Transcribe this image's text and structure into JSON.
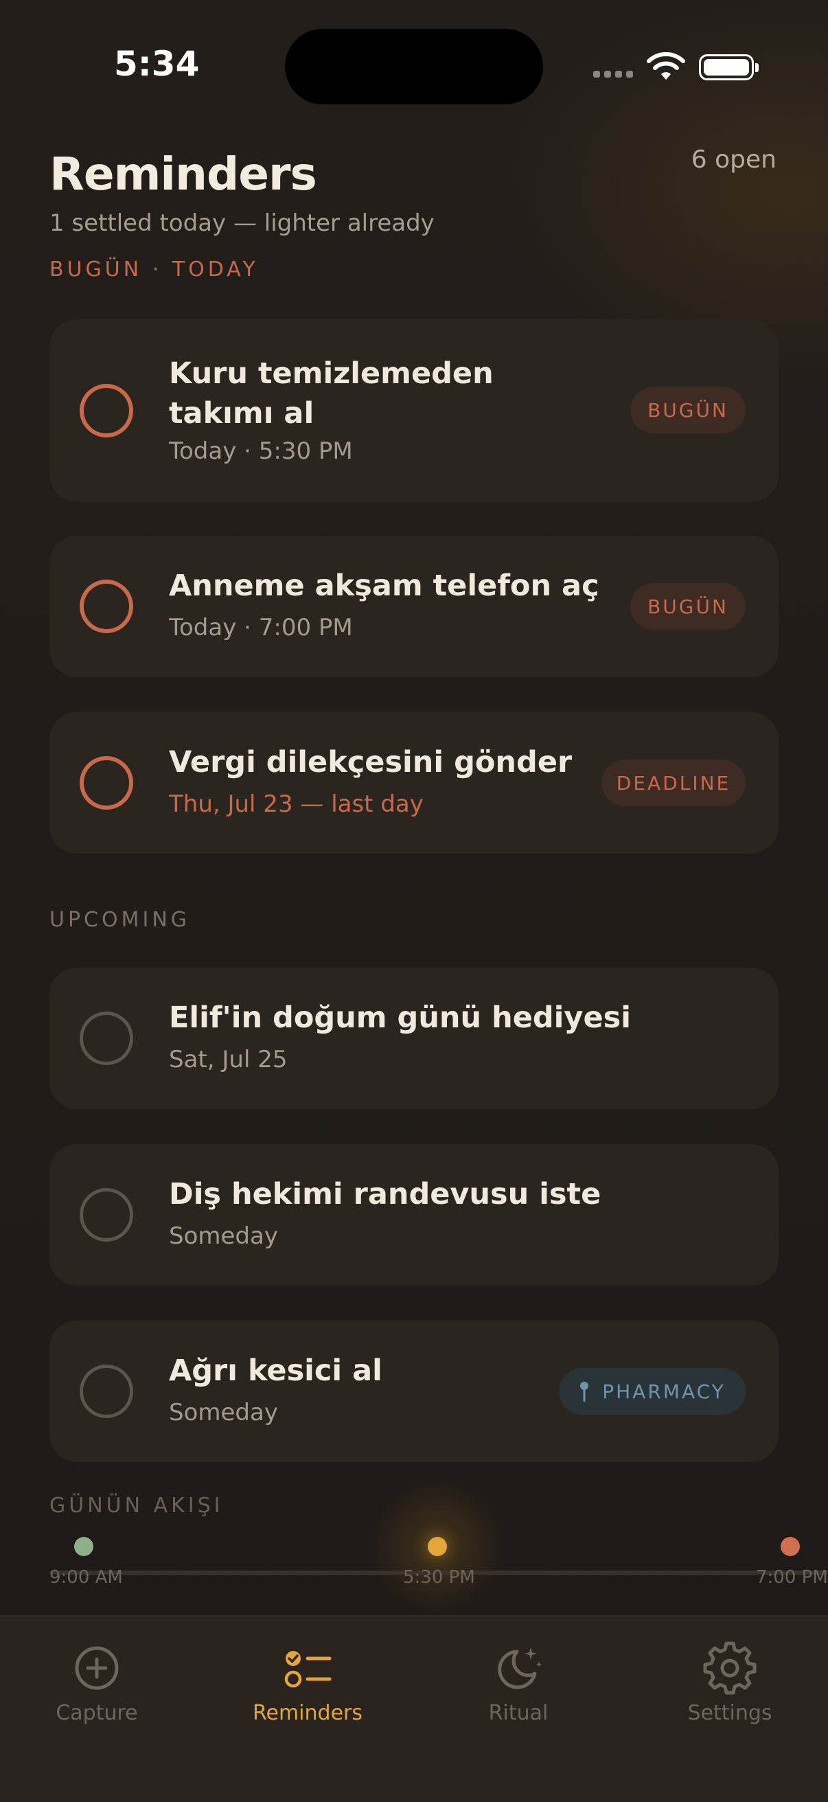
{
  "status_bar": {
    "time": "5:34"
  },
  "header": {
    "title": "Reminders",
    "open_count": "6 open",
    "subtitle": "1 settled today — lighter already"
  },
  "sections": {
    "today": "BUGÜN · TODAY",
    "upcoming": "UPCOMING",
    "flow": "GÜNÜN AKIŞI"
  },
  "today_items": [
    {
      "title_line1": "Kuru temizlemeden",
      "title_line2": "takımı al",
      "subtitle": "Today · 5:30 PM",
      "tag": "BUGÜN"
    },
    {
      "title": "Anneme akşam telefon aç",
      "subtitle": "Today · 7:00 PM",
      "tag": "BUGÜN"
    },
    {
      "title": "Vergi dilekçesini gönder",
      "subtitle": "Thu, Jul 23 — last day",
      "tag": "DEADLINE"
    }
  ],
  "upcoming_items": [
    {
      "title": "Elif'in doğum günü hediyesi",
      "subtitle": "Sat, Jul 25"
    },
    {
      "title": "Diş hekimi randevusu iste",
      "subtitle": "Someday"
    },
    {
      "title": "Ağrı kesici al",
      "subtitle": "Someday",
      "tag": "PHARMACY"
    }
  ],
  "timeline": {
    "points": [
      {
        "time": "9:00 AM",
        "color": "#8fae8a"
      },
      {
        "time": "5:30 PM",
        "color": "#e3a63a"
      },
      {
        "time": "7:00 PM",
        "color": "#d0704f"
      }
    ]
  },
  "tabs": [
    {
      "label": "Capture",
      "icon": "plus-circle-icon"
    },
    {
      "label": "Reminders",
      "icon": "checklist-icon",
      "active": true
    },
    {
      "label": "Ritual",
      "icon": "moon-stars-icon"
    },
    {
      "label": "Settings",
      "icon": "gear-icon"
    }
  ],
  "colors": {
    "accent": "#e3a63a",
    "warn": "#c8694a",
    "location": "#6e95ab",
    "background": "#231e1a"
  }
}
